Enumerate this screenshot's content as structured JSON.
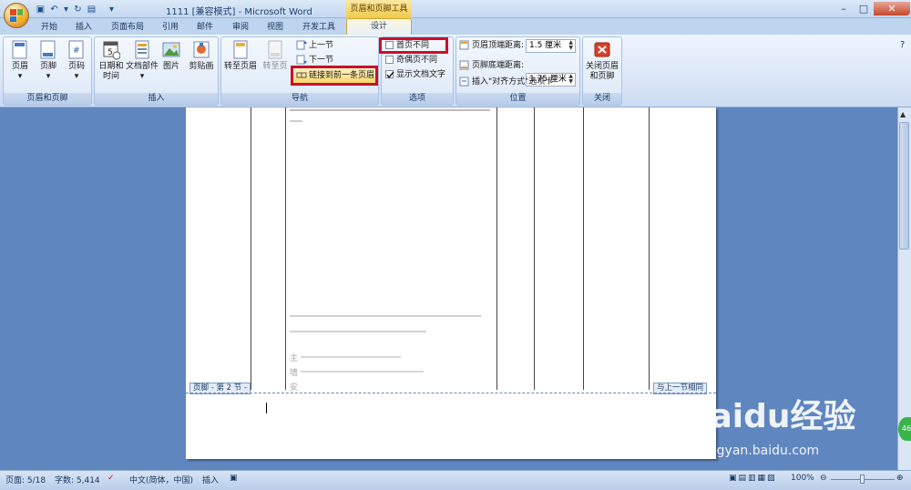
{
  "window": {
    "title": "1111 [兼容模式] - Microsoft Word",
    "context_tab_header": "页眉和页脚工具",
    "minimize": "–",
    "maximize": "□",
    "close": "✕"
  },
  "quick_access": [
    {
      "name": "save-icon",
      "glyph": "▣"
    },
    {
      "name": "undo-icon",
      "glyph": "↶"
    },
    {
      "name": "dropdown-icon",
      "glyph": "▾"
    },
    {
      "name": "redo-icon",
      "glyph": "↻"
    },
    {
      "name": "print-preview-icon",
      "glyph": "▤"
    },
    {
      "name": "customize-icon",
      "glyph": "▾"
    }
  ],
  "tabs": [
    {
      "label": "开始"
    },
    {
      "label": "插入"
    },
    {
      "label": "页面布局"
    },
    {
      "label": "引用"
    },
    {
      "label": "邮件"
    },
    {
      "label": "审阅"
    },
    {
      "label": "视图"
    },
    {
      "label": "开发工具"
    },
    {
      "label": "设计"
    }
  ],
  "ribbon": {
    "group_header_footer": {
      "label": "页眉和页脚",
      "header": "页眉",
      "footer": "页脚",
      "page_number": "页码"
    },
    "group_insert": {
      "label": "插入",
      "date_time_line1": "日期和",
      "date_time_line2": "时间",
      "doc_parts": "文档部件",
      "picture": "图片",
      "clipart": "剪贴画"
    },
    "group_nav": {
      "label": "导航",
      "goto_header": "转至页眉",
      "goto_footer": "转至页",
      "prev_section": "上一节",
      "next_section": "下一节",
      "link_previous": "链接到前一条页眉"
    },
    "group_options": {
      "label": "选项",
      "different_first": "首页不同",
      "different_odd_even": "奇偶页不同",
      "show_doc_text": "显示文档文字"
    },
    "group_position": {
      "label": "位置",
      "header_from_top_label": "页眉顶端距离:",
      "header_from_top_value": "1.5 厘米",
      "footer_from_bottom_label": "页脚底端距离:",
      "footer_from_bottom_value": "1.75 厘米",
      "insert_alignment_tab": "插入\"对齐方式\"选项卡"
    },
    "group_close": {
      "label": "关闭",
      "close_line1": "关闭页眉",
      "close_line2": "和页脚"
    }
  },
  "document": {
    "footer_tag": "页脚 - 第 2 节 -",
    "same_as_previous": "与上一节相同",
    "ghost_text": [
      "主",
      "墙",
      "安"
    ]
  },
  "status": {
    "page": "页面: 5/18",
    "words": "字数: 5,414",
    "language": "中文(简体，中国)",
    "insert_mode": "插入",
    "zoom": "100%"
  },
  "watermark": {
    "brand": "Baidu经验",
    "url": "jingyan.baidu.com",
    "badge": "46"
  }
}
